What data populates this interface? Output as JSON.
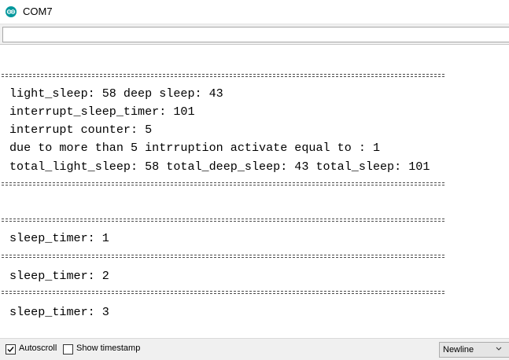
{
  "window": {
    "title": "COM7",
    "icon": "arduino-logo-icon"
  },
  "input": {
    "value": "",
    "placeholder": ""
  },
  "output": {
    "lines": [
      "light_sleep: 58 deep sleep: 43",
      "interrupt_sleep_timer: 101",
      "interrupt counter: 5",
      "due to more than 5 intrruption activate equal to : 1",
      "total_light_sleep: 58 total_deep_sleep: 43 total_sleep: 101",
      "sleep_timer: 1",
      "sleep_timer: 2",
      "sleep_timer: 3"
    ]
  },
  "status": {
    "autoscroll_label": "Autoscroll",
    "autoscroll_checked": true,
    "timestamp_label": "Show timestamp",
    "timestamp_checked": false,
    "line_ending": "Newline"
  },
  "colors": {
    "accent": "#00979c"
  }
}
